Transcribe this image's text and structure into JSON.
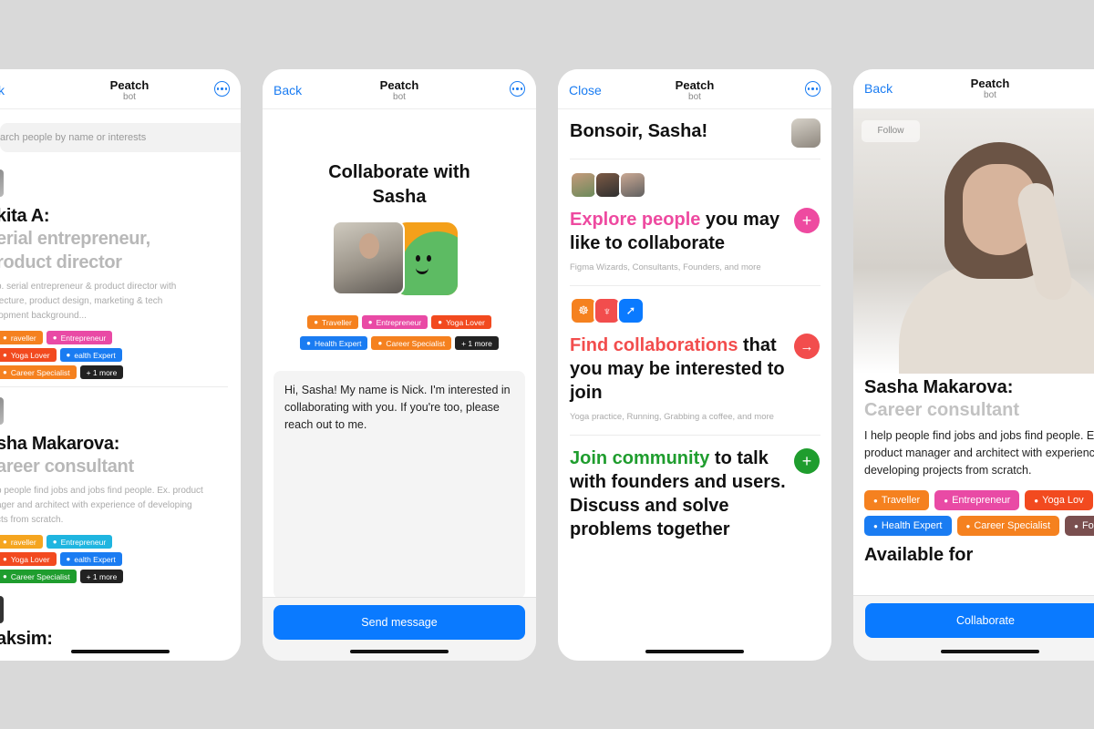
{
  "colors": {
    "accent": "#0a7aff",
    "pink": "#ee4aa0",
    "red": "#f24d4d",
    "green": "#1f9d2e"
  },
  "screen1": {
    "back": "k",
    "title": "Peatch",
    "subtitle": "bot",
    "search_placeholder": "arch people by name or interests",
    "profiles": [
      {
        "name": "kita A:",
        "role1": "erial entrepreneur,",
        "role2": "roduct director",
        "desc": [
          "p. serial entrepreneur & product director with",
          "tecture, product design, marketing & tech",
          "lopment background..."
        ],
        "tags": [
          [
            "raveller",
            "#f5811f"
          ],
          [
            "Entrepreneur",
            "#e94aa5"
          ],
          [
            "Yoga Lover",
            "#f24a1f"
          ],
          [
            "ealth Expert",
            "#1a7cf2"
          ],
          [
            "Career Specialist",
            "#f5811f"
          ],
          [
            "+ 1 more",
            "#222222"
          ]
        ]
      },
      {
        "name": "sha Makarova:",
        "role1": "areer consultant",
        "role2": "",
        "desc": [
          "p people find jobs and jobs find people. Ex. product",
          "ager and architect with experience of developing",
          "cts from scratch."
        ],
        "tags": [
          [
            "raveller",
            "#f5a51f"
          ],
          [
            "Entrepreneur",
            "#1fb5e0"
          ],
          [
            "Yoga Lover",
            "#f24a1f"
          ],
          [
            "ealth Expert",
            "#1a7cf2"
          ],
          [
            "Career Specialist",
            "#1f9d2e"
          ],
          [
            "+ 1 more",
            "#222222"
          ]
        ]
      }
    ],
    "third_name": "aksim:"
  },
  "screen2": {
    "back": "Back",
    "title": "Peatch",
    "subtitle": "bot",
    "heading": [
      "Collaborate with",
      "Sasha"
    ],
    "tags_row1": [
      [
        "Traveller",
        "#f5811f"
      ],
      [
        "Entrepreneur",
        "#e94aa5"
      ],
      [
        "Yoga Lover",
        "#f24a1f"
      ]
    ],
    "tags_row2": [
      [
        "Health Expert",
        "#1a7cf2"
      ],
      [
        "Career Specialist",
        "#f5811f"
      ],
      [
        "+ 1 more",
        "#222222"
      ]
    ],
    "message": "Hi, Sasha! My name is Nick. I'm interested in collaborating with you. If you're too, please reach out to me.",
    "send": "Send message"
  },
  "screen3": {
    "close": "Close",
    "title": "Peatch",
    "subtitle": "bot",
    "greeting": "Bonsoir, Sasha!",
    "explore_hl": "Explore people",
    "explore_rest": " you may like to collaborate",
    "explore_note": "Figma Wizards, Consultants, Founders, and more",
    "find_hl": "Find collaborations",
    "find_rest": " that you may be interested to join",
    "find_note": "Yoga practice, Running, Grabbing a coffee, and more",
    "join_hl": "Join community",
    "join_rest": " to talk with founders and users. Discuss and solve problems together"
  },
  "screen4": {
    "back": "Back",
    "title": "Peatch",
    "subtitle": "bot",
    "follow": "Follow",
    "name": "Sasha Makarova:",
    "role": "Career consultant",
    "desc": "I help people find jobs and jobs find people. Ex. product manager and architect with experience developing projects from scratch.",
    "tags": [
      [
        "Traveller",
        "#f5811f"
      ],
      [
        "Entrepreneur",
        "#e94aa5"
      ],
      [
        "Yoga Lov",
        "#f24a1f"
      ],
      [
        "Health Expert",
        "#1a7cf2"
      ],
      [
        "Career Specialist",
        "#f5811f"
      ],
      [
        "Foodie",
        "#7a4f4f"
      ]
    ],
    "available": "Available for",
    "collaborate": "Collaborate"
  }
}
